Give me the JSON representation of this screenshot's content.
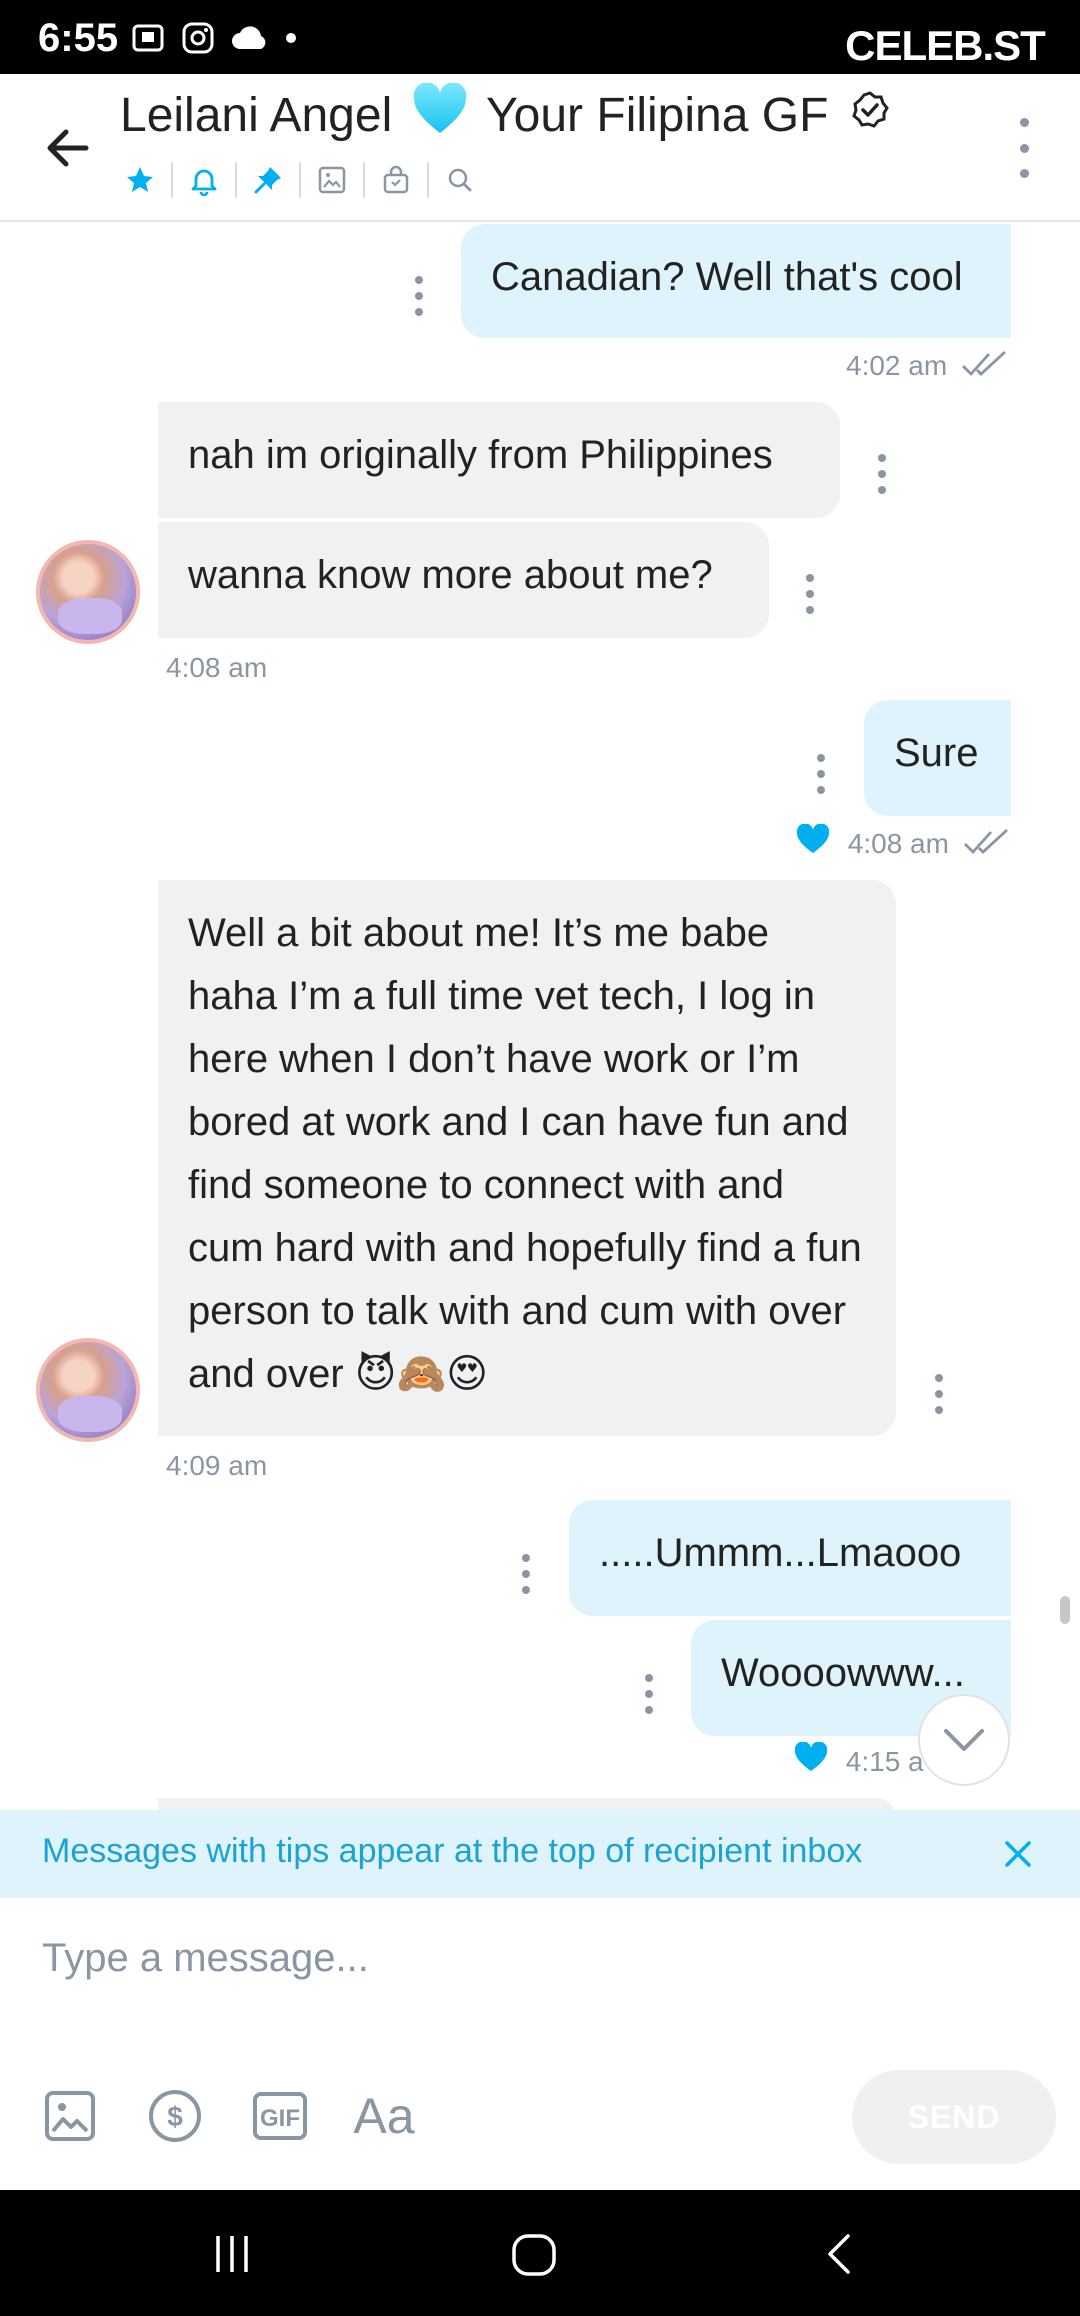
{
  "status_bar": {
    "time": "6:55",
    "watermark": "CELEB.ST"
  },
  "header": {
    "title_part1": "Leilani Angel",
    "title_part2": "Your Filipina GF",
    "tab_icons": [
      "star-icon",
      "bell-icon",
      "pin-icon",
      "image-icon",
      "lock-bag-icon",
      "search-icon"
    ]
  },
  "messages": [
    {
      "direction": "out",
      "text": "Canadian? Well that's cool"
    },
    {
      "direction": "meta",
      "text": "4:02 am"
    },
    {
      "direction": "in",
      "text": "nah im originally from Philippines"
    },
    {
      "direction": "in",
      "text": "wanna know more about me?"
    },
    {
      "direction": "meta",
      "text": "4:08 am"
    },
    {
      "direction": "out",
      "text": "Sure"
    },
    {
      "direction": "meta",
      "text": "4:08 am"
    },
    {
      "direction": "in",
      "text": "Well a bit about me! It’s me babe haha I’m a full time vet tech, I log in here when I don’t have work or I’m bored at work and I can have fun and find someone to connect with and cum hard with and hopefully find a fun person to talk with and cum with over and over 😈🙈😍"
    },
    {
      "direction": "meta",
      "text": "4:09 am"
    },
    {
      "direction": "out",
      "text": ".....Ummm...Lmaooo"
    },
    {
      "direction": "out",
      "text": "Woooowww..."
    },
    {
      "direction": "meta",
      "text": "4:15 a"
    }
  ],
  "tips_banner": {
    "text": "Messages with tips appear at the top of recipient inbox"
  },
  "composer": {
    "placeholder": "Type a message...",
    "text_tool_label": "Aa",
    "send_label": "SEND"
  },
  "colors": {
    "accent": "#00aff0",
    "outgoing_bubble": "#dff3fc",
    "incoming_bubble": "#f0f1f3",
    "muted": "#8a96a3"
  }
}
